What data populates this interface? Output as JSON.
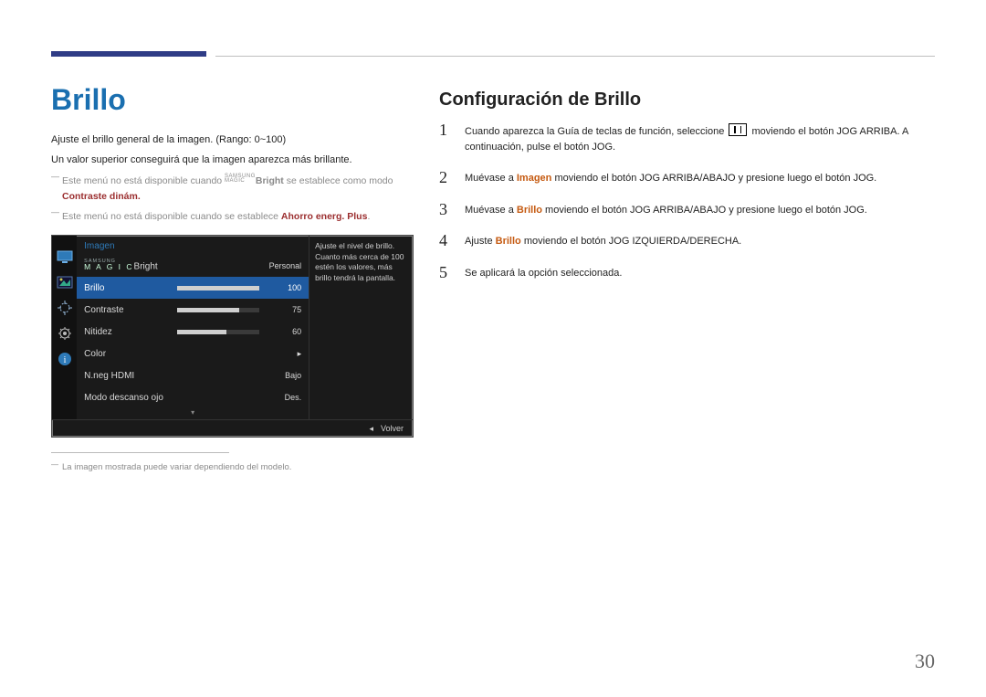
{
  "page_number": "30",
  "left": {
    "heading": "Brillo",
    "desc1": "Ajuste el brillo general de la imagen. (Rango: 0~100)",
    "desc2": "Un valor superior conseguirá que la imagen aparezca más brillante.",
    "note1_a": "Este menú no está disponible cuando ",
    "note1_magic_top": "SAMSUNG",
    "note1_magic_bot": "MAGIC",
    "note1_b": "Bright",
    "note1_c": " se establece como modo ",
    "note1_d": "Contraste dinám.",
    "note2_a": "Este menú no está disponible cuando se establece ",
    "note2_b": "Ahorro energ. Plus",
    "note2_c": ".",
    "footnote": "La imagen mostrada puede variar dependiendo del modelo."
  },
  "osd": {
    "section": "Imagen",
    "desc": "Ajuste el nivel de brillo. Cuanto más cerca de 100 estén los valores, más brillo tendrá la pantalla.",
    "rows": [
      {
        "label_top": "SAMSUNG",
        "label_bot": "M A G I C",
        "suffix": "Bright",
        "value": "Personal",
        "type": "text"
      },
      {
        "label": "Brillo",
        "value": "100",
        "type": "slider",
        "fill": 100,
        "selected": true
      },
      {
        "label": "Contraste",
        "value": "75",
        "type": "slider",
        "fill": 75
      },
      {
        "label": "Nitidez",
        "value": "60",
        "type": "slider",
        "fill": 60
      },
      {
        "label": "Color",
        "type": "arrow"
      },
      {
        "label": "N.neg HDMI",
        "value": "Bajo",
        "type": "text"
      },
      {
        "label": "Modo descanso ojo",
        "value": "Des.",
        "type": "text"
      }
    ],
    "back_label": "Volver",
    "back_glyph": "◂"
  },
  "right": {
    "heading": "Configuración de Brillo",
    "steps": [
      {
        "num": "1",
        "text_a": "Cuando aparezca la Guía de teclas de función, seleccione ",
        "has_icon": true,
        "text_b": " moviendo el botón JOG ARRIBA. A continuación, pulse el botón JOG."
      },
      {
        "num": "2",
        "text_a": "Muévase a ",
        "em1": "Imagen",
        "text_b": " moviendo el botón JOG ARRIBA/ABAJO y presione luego el botón JOG."
      },
      {
        "num": "3",
        "text_a": "Muévase a ",
        "em1": "Brillo",
        "text_b": " moviendo el botón JOG ARRIBA/ABAJO y presione luego el botón JOG."
      },
      {
        "num": "4",
        "text_a": "Ajuste ",
        "em1": "Brillo",
        "text_b": " moviendo el botón JOG IZQUIERDA/DERECHA."
      },
      {
        "num": "5",
        "text_a": "Se aplicará la opción seleccionada."
      }
    ]
  }
}
